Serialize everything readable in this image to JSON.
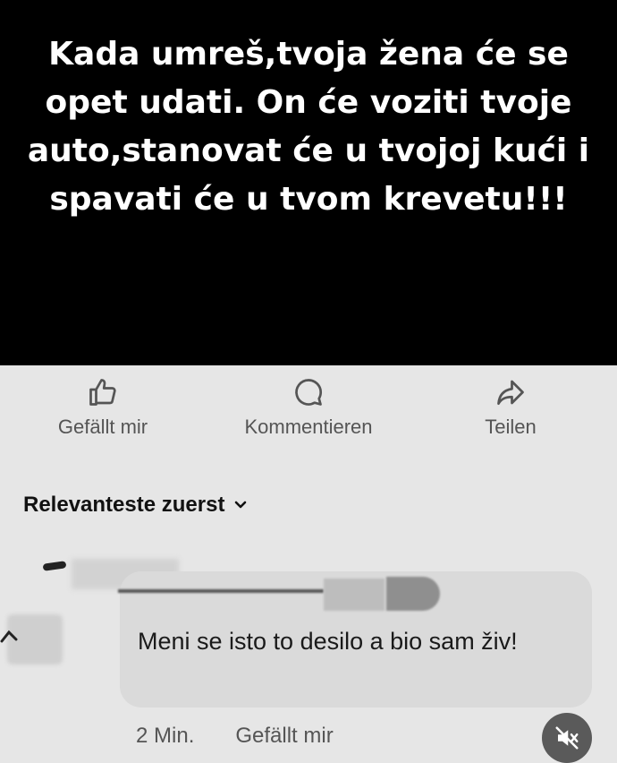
{
  "post": {
    "text": "Kada umreš,tvoja žena će se opet udati. On će voziti tvoje auto,stanovat će u tvojoj kući i spavati će u tvom krevetu!!!"
  },
  "actions": {
    "like_label": "Gefällt mir",
    "comment_label": "Kommentieren",
    "share_label": "Teilen"
  },
  "sort": {
    "label": "Relevanteste zuerst"
  },
  "comment": {
    "text": "Meni se isto to desilo a bio sam živ!",
    "time": "2 Min.",
    "like_label": "Gefällt mir"
  },
  "icons": {
    "like": "thumbs-up-icon",
    "comment": "speech-bubble-icon",
    "share": "share-arrow-icon",
    "sort": "chevron-down-icon",
    "mute": "speaker-muted-icon"
  },
  "colors": {
    "post_background": "#000000",
    "page_background": "#e6e6e6",
    "bubble_background": "#dadada"
  }
}
